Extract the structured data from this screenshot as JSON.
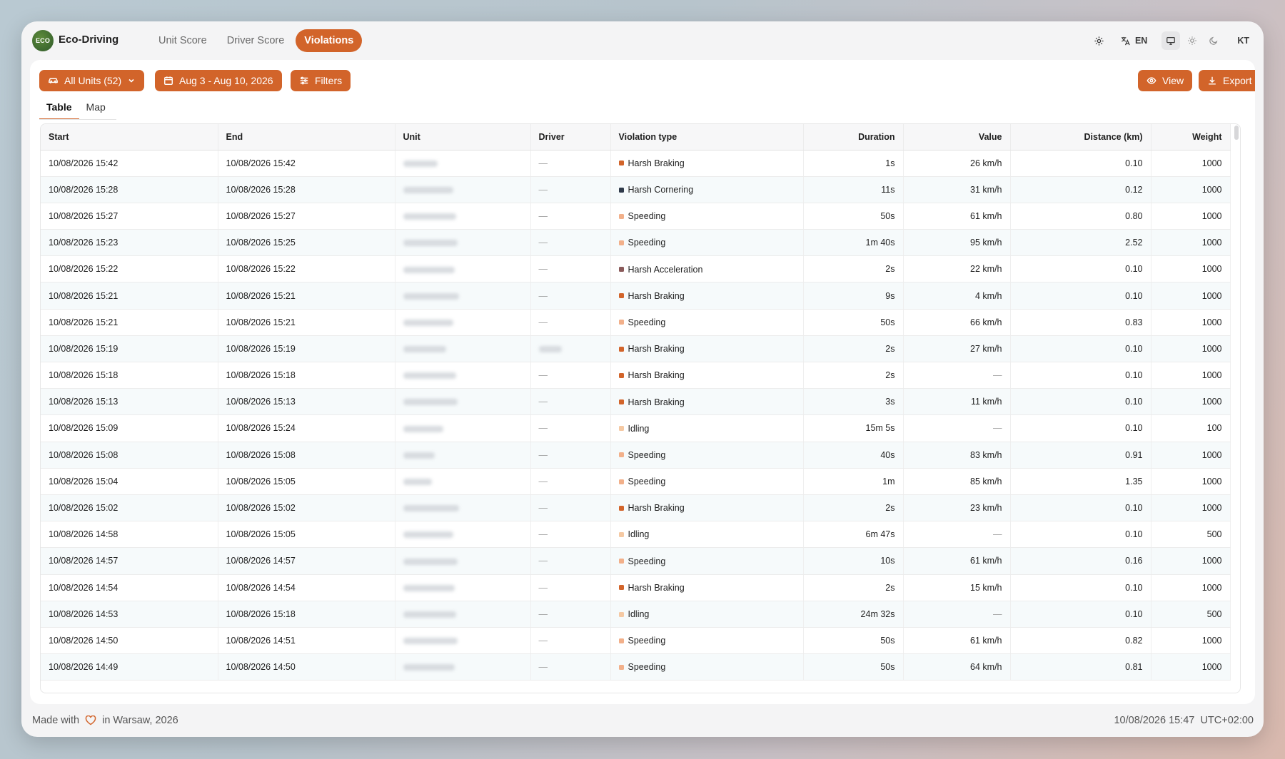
{
  "app": {
    "logo_text": "ECO",
    "title": "Eco-Driving"
  },
  "nav": {
    "tabs": [
      {
        "label": "Unit Score"
      },
      {
        "label": "Driver Score"
      },
      {
        "label": "Violations",
        "active": true
      }
    ]
  },
  "topbar": {
    "language": "EN",
    "user_initials": "KT",
    "active_mode": "monitor"
  },
  "toolbar": {
    "units_label": "All Units (52)",
    "date_range": "Aug 3 - Aug 10, 2026",
    "filters_label": "Filters",
    "view_label": "View",
    "export_label": "Export"
  },
  "view_tabs": [
    {
      "label": "Table",
      "active": true
    },
    {
      "label": "Map"
    }
  ],
  "table": {
    "columns": [
      "Start",
      "End",
      "Unit",
      "Driver",
      "Violation type",
      "Duration",
      "Value",
      "Distance (km)",
      "Weight"
    ],
    "violation_colors": {
      "Harsh Braking": "#d2642a",
      "Harsh Cornering": "#2f3a4a",
      "Speeding": "#f2b08a",
      "Harsh Acceleration": "#8a5a5a",
      "Idling": "#f5c9a3"
    },
    "rows": [
      {
        "start": "10/08/2026 15:42",
        "end": "10/08/2026 15:42",
        "driver": "—",
        "type": "Harsh Braking",
        "duration": "1s",
        "value": "26 km/h",
        "distance": "0.10",
        "weight": "1000"
      },
      {
        "start": "10/08/2026 15:28",
        "end": "10/08/2026 15:28",
        "driver": "—",
        "type": "Harsh Cornering",
        "duration": "11s",
        "value": "31 km/h",
        "distance": "0.12",
        "weight": "1000"
      },
      {
        "start": "10/08/2026 15:27",
        "end": "10/08/2026 15:27",
        "driver": "—",
        "type": "Speeding",
        "duration": "50s",
        "value": "61 km/h",
        "distance": "0.80",
        "weight": "1000"
      },
      {
        "start": "10/08/2026 15:23",
        "end": "10/08/2026 15:25",
        "driver": "—",
        "type": "Speeding",
        "duration": "1m 40s",
        "value": "95 km/h",
        "distance": "2.52",
        "weight": "1000"
      },
      {
        "start": "10/08/2026 15:22",
        "end": "10/08/2026 15:22",
        "driver": "—",
        "type": "Harsh Acceleration",
        "duration": "2s",
        "value": "22 km/h",
        "distance": "0.10",
        "weight": "1000"
      },
      {
        "start": "10/08/2026 15:21",
        "end": "10/08/2026 15:21",
        "driver": "—",
        "type": "Harsh Braking",
        "duration": "9s",
        "value": "4 km/h",
        "distance": "0.10",
        "weight": "1000"
      },
      {
        "start": "10/08/2026 15:21",
        "end": "10/08/2026 15:21",
        "driver": "—",
        "type": "Speeding",
        "duration": "50s",
        "value": "66 km/h",
        "distance": "0.83",
        "weight": "1000"
      },
      {
        "start": "10/08/2026 15:19",
        "end": "10/08/2026 15:19",
        "driver": "",
        "type": "Harsh Braking",
        "duration": "2s",
        "value": "27 km/h",
        "distance": "0.10",
        "weight": "1000"
      },
      {
        "start": "10/08/2026 15:18",
        "end": "10/08/2026 15:18",
        "driver": "—",
        "type": "Harsh Braking",
        "duration": "2s",
        "value": "—",
        "distance": "0.10",
        "weight": "1000"
      },
      {
        "start": "10/08/2026 15:13",
        "end": "10/08/2026 15:13",
        "driver": "—",
        "type": "Harsh Braking",
        "duration": "3s",
        "value": "11 km/h",
        "distance": "0.10",
        "weight": "1000"
      },
      {
        "start": "10/08/2026 15:09",
        "end": "10/08/2026 15:24",
        "driver": "—",
        "type": "Idling",
        "duration": "15m 5s",
        "value": "—",
        "distance": "0.10",
        "weight": "100"
      },
      {
        "start": "10/08/2026 15:08",
        "end": "10/08/2026 15:08",
        "driver": "—",
        "type": "Speeding",
        "duration": "40s",
        "value": "83 km/h",
        "distance": "0.91",
        "weight": "1000"
      },
      {
        "start": "10/08/2026 15:04",
        "end": "10/08/2026 15:05",
        "driver": "—",
        "type": "Speeding",
        "duration": "1m",
        "value": "85 km/h",
        "distance": "1.35",
        "weight": "1000"
      },
      {
        "start": "10/08/2026 15:02",
        "end": "10/08/2026 15:02",
        "driver": "—",
        "type": "Harsh Braking",
        "duration": "2s",
        "value": "23 km/h",
        "distance": "0.10",
        "weight": "1000"
      },
      {
        "start": "10/08/2026 14:58",
        "end": "10/08/2026 15:05",
        "driver": "—",
        "type": "Idling",
        "duration": "6m 47s",
        "value": "—",
        "distance": "0.10",
        "weight": "500"
      },
      {
        "start": "10/08/2026 14:57",
        "end": "10/08/2026 14:57",
        "driver": "—",
        "type": "Speeding",
        "duration": "10s",
        "value": "61 km/h",
        "distance": "0.16",
        "weight": "1000"
      },
      {
        "start": "10/08/2026 14:54",
        "end": "10/08/2026 14:54",
        "driver": "—",
        "type": "Harsh Braking",
        "duration": "2s",
        "value": "15 km/h",
        "distance": "0.10",
        "weight": "1000"
      },
      {
        "start": "10/08/2026 14:53",
        "end": "10/08/2026 15:18",
        "driver": "—",
        "type": "Idling",
        "duration": "24m 32s",
        "value": "—",
        "distance": "0.10",
        "weight": "500"
      },
      {
        "start": "10/08/2026 14:50",
        "end": "10/08/2026 14:51",
        "driver": "—",
        "type": "Speeding",
        "duration": "50s",
        "value": "61 km/h",
        "distance": "0.82",
        "weight": "1000"
      },
      {
        "start": "10/08/2026 14:49",
        "end": "10/08/2026 14:50",
        "driver": "—",
        "type": "Speeding",
        "duration": "50s",
        "value": "64 km/h",
        "distance": "0.81",
        "weight": "1000"
      }
    ]
  },
  "footer": {
    "made_with": "Made with",
    "location": "in Warsaw, 2026",
    "datetime": "10/08/2026 15:47",
    "timezone": "UTC+02:00"
  },
  "colors": {
    "accent": "#d2642a"
  }
}
